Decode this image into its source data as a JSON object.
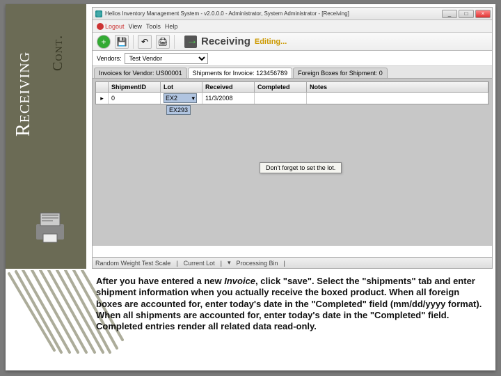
{
  "slide": {
    "title": "Receiving",
    "subtitle": "Cont."
  },
  "window": {
    "title": "Helios Inventory Management System - v2.0.0.0 - Administrator, System Administrator - [Receiving]",
    "menubar": {
      "items": [
        "Logout",
        "View",
        "Tools",
        "Help"
      ]
    },
    "toolbar": {
      "add_icon": "+",
      "save_icon": "💾",
      "undo_icon": "↶",
      "print_icon": "🖨"
    },
    "page_title": "Receiving",
    "mode": "Editing...",
    "vendor": {
      "label": "Vendors:",
      "selected": "Test Vendor"
    },
    "tabs": {
      "invoices": "Invoices for Vendor: US00001",
      "shipments": "Shipments for Invoice: 123456789",
      "foreign": "Foreign Boxes for Shipment: 0"
    },
    "grid": {
      "headers": {
        "shipment": "ShipmentID",
        "lot": "Lot",
        "received": "Received",
        "completed": "Completed",
        "notes": "Notes"
      },
      "row": {
        "indicator": "▸",
        "shipment": "0",
        "lot": "EX2",
        "lot_arrow": "▾",
        "received": "11/3/2008",
        "completed": "",
        "notes": ""
      },
      "lot_dropdown_option": "EX293"
    },
    "tooltip": "Don't forget to set the lot.",
    "statusbar": {
      "a": "Random Weight Test Scale",
      "b": "Current Lot",
      "c": "Processing Bin"
    }
  },
  "caption": {
    "text1a": "After you have entered a new ",
    "text1b": "Invoice",
    "text1c": ", click \"save\". Select the \"shipments\" tab and enter shipment information when you actually receive the boxed product. When all foreign boxes are accounted for, enter today's date in the \"Completed\" field (mm/dd/yyyy format). When all shipments are accounted for, enter today's date in the \"Completed\" field. Completed entries render all related data read-only."
  }
}
